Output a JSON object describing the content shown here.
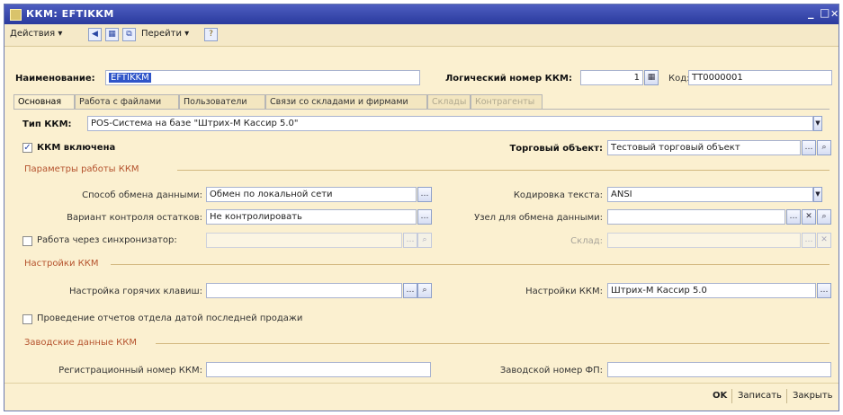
{
  "window": {
    "title": "ККМ: EFTIKKM",
    "minimize": "_",
    "maximize": "□",
    "close": "✕"
  },
  "toolbar": {
    "actions": "Действия ▾",
    "goto": "Перейти ▾",
    "help": "?"
  },
  "header": {
    "name_label": "Наименование:",
    "name_value": "EFTIKKM",
    "logical_label": "Логический номер ККМ:",
    "logical_value": "1",
    "code_label": "Код:",
    "code_value": "ТТ0000001"
  },
  "tabs": [
    {
      "label": "Основная"
    },
    {
      "label": "Работа с файлами"
    },
    {
      "label": "Пользователи"
    },
    {
      "label": "Связи со складами и фирмами"
    },
    {
      "label": "Склады"
    },
    {
      "label": "Контрагенты"
    }
  ],
  "main": {
    "kkm_type_label": "Тип ККМ:",
    "kkm_type_value": "POS-Система на базе \"Штрих-М Кассир 5.0\"",
    "kkm_enabled_label": "ККМ включена",
    "trade_object_label": "Торговый объект:",
    "trade_object_value": "Тестовый торговый объект",
    "section_params": "Параметры работы ККМ",
    "exchange_method_label": "Способ обмена данными:",
    "exchange_method_value": "Обмен по локальной сети",
    "encoding_label": "Кодировка текста:",
    "encoding_value": "ANSI",
    "stock_control_label": "Вариант контроля остатков:",
    "stock_control_value": "Не контролировать",
    "exchange_node_label": "Узел для обмена данными:",
    "exchange_node_value": "",
    "sync_label": "Работа через синхронизатор:",
    "warehouse_label": "Склад:",
    "section_settings": "Настройки ККМ",
    "hotkeys_label": "Настройка горячих клавиш:",
    "kkm_settings_label": "Настройки ККМ:",
    "kkm_settings_value": "Штрих-М Кассир 5.0",
    "reports_label": "Проведение отчетов отдела датой последней продажи",
    "section_factory": "Заводские данные ККМ",
    "reg_number_label": "Регистрационный номер ККМ:",
    "factory_fp_label": "Заводской номер ФП:"
  },
  "footer": {
    "ok": "OK",
    "save": "Записать",
    "close": "Закрыть"
  }
}
